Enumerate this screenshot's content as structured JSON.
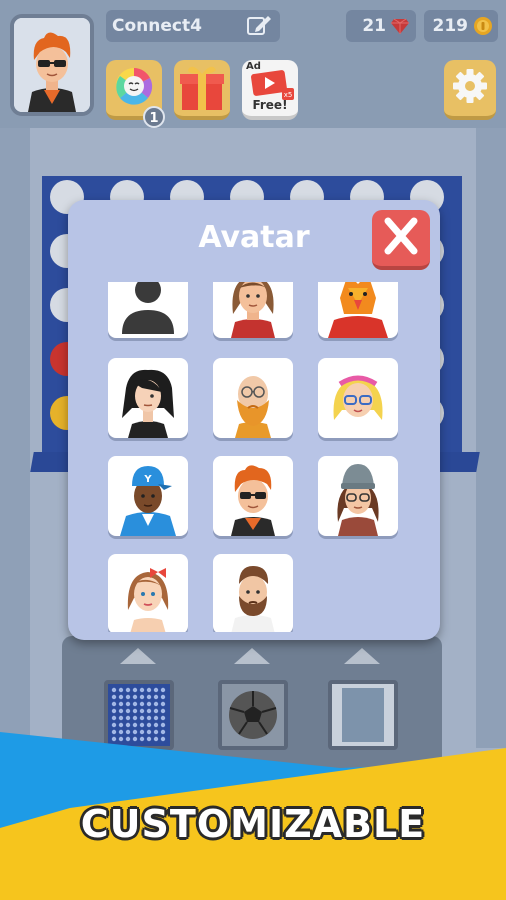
{
  "header": {
    "player_name": "Connect4",
    "gems": "21",
    "coins": "219",
    "notification_count": "1",
    "ad_tag": "Ad",
    "ad_free_label": "Free!"
  },
  "modal": {
    "title": "Avatar",
    "avatars": [
      {
        "name": "default-silhouette"
      },
      {
        "name": "brown-hair-woman"
      },
      {
        "name": "orange-bird-mask"
      },
      {
        "name": "black-hair-emo"
      },
      {
        "name": "bald-ginger-beard"
      },
      {
        "name": "blonde-glasses-girl"
      },
      {
        "name": "cap-hoodie-guy"
      },
      {
        "name": "sunglasses-redhead"
      },
      {
        "name": "beanie-glasses-woman"
      },
      {
        "name": "bow-girl"
      },
      {
        "name": "bearded-man"
      }
    ]
  },
  "banner": {
    "caption": "CUSTOMIZABLE"
  },
  "colors": {
    "board_blue": "#2d4c9c",
    "modal_bg": "#b8c4e6",
    "close_red": "#e65b58",
    "gold": "#e8c064",
    "banner_blue": "#1e9be6",
    "banner_yellow": "#f6c51d"
  }
}
